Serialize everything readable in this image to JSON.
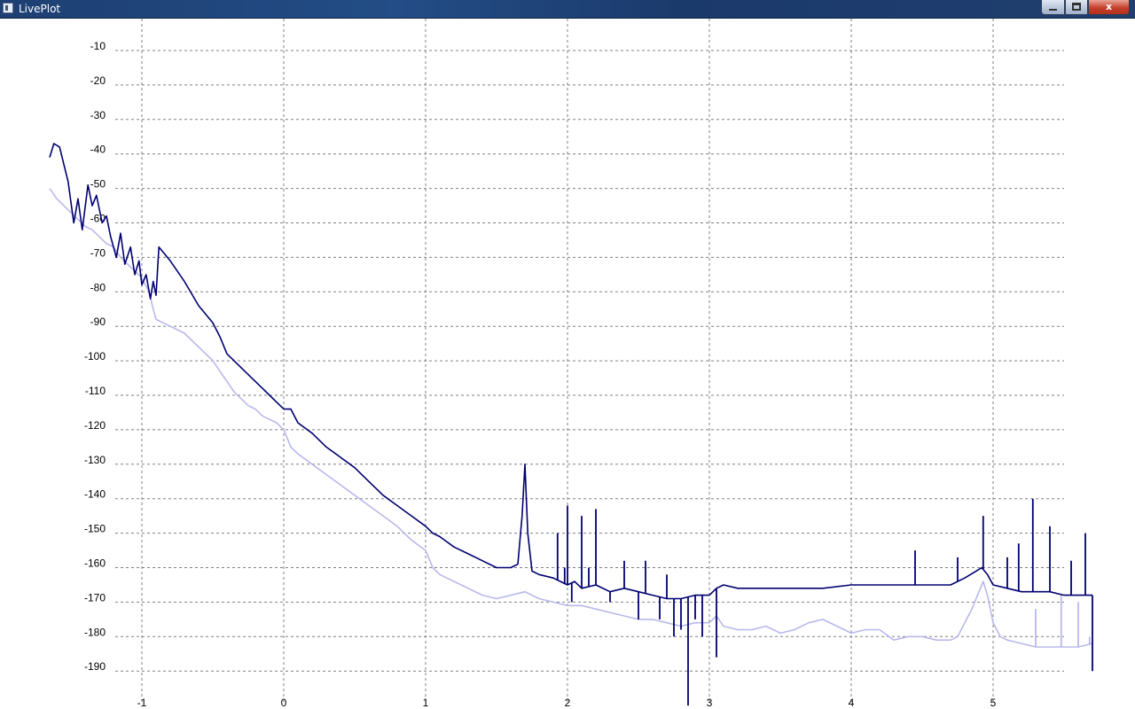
{
  "window": {
    "title": "LivePlot",
    "minimize_label": "",
    "maximize_label": "",
    "close_label": "x"
  },
  "chart_data": {
    "type": "line",
    "title": "",
    "xlabel": "",
    "ylabel": "",
    "xlim": [
      -1.65,
      5.7
    ],
    "ylim": [
      -198,
      0
    ],
    "x_ticks": [
      -1,
      0,
      1,
      2,
      3,
      4,
      5
    ],
    "y_ticks": [
      -10,
      -20,
      -30,
      -40,
      -50,
      -60,
      -70,
      -80,
      -90,
      -100,
      -110,
      -120,
      -130,
      -140,
      -150,
      -160,
      -170,
      -180,
      -190
    ],
    "grid": true,
    "grid_style": "dashed",
    "colors": {
      "dark": "#000070",
      "light": "#b8b8ec",
      "grid": "#808080"
    },
    "series": [
      {
        "color": "#000070",
        "points": [
          [
            -1.65,
            -41
          ],
          [
            -1.62,
            -37
          ],
          [
            -1.58,
            -38
          ],
          [
            -1.55,
            -43
          ],
          [
            -1.52,
            -48
          ],
          [
            -1.48,
            -60
          ],
          [
            -1.45,
            -53
          ],
          [
            -1.42,
            -62
          ],
          [
            -1.38,
            -49
          ],
          [
            -1.35,
            -55
          ],
          [
            -1.32,
            -52
          ],
          [
            -1.28,
            -60
          ],
          [
            -1.25,
            -58
          ],
          [
            -1.22,
            -64
          ],
          [
            -1.18,
            -70
          ],
          [
            -1.15,
            -63
          ],
          [
            -1.12,
            -72
          ],
          [
            -1.08,
            -67
          ],
          [
            -1.05,
            -75
          ],
          [
            -1.02,
            -71
          ],
          [
            -1.0,
            -78
          ],
          [
            -0.97,
            -75
          ],
          [
            -0.94,
            -82
          ],
          [
            -0.92,
            -77
          ],
          [
            -0.9,
            -81
          ],
          [
            -0.88,
            -67
          ],
          [
            -0.8,
            -71
          ],
          [
            -0.7,
            -77
          ],
          [
            -0.6,
            -84
          ],
          [
            -0.5,
            -89
          ],
          [
            -0.45,
            -93
          ],
          [
            -0.4,
            -98
          ],
          [
            -0.35,
            -100
          ],
          [
            -0.3,
            -102
          ],
          [
            -0.25,
            -104
          ],
          [
            -0.2,
            -106
          ],
          [
            -0.15,
            -108
          ],
          [
            -0.1,
            -110
          ],
          [
            -0.05,
            -112
          ],
          [
            0.0,
            -114
          ],
          [
            0.05,
            -114
          ],
          [
            0.1,
            -118
          ],
          [
            0.2,
            -121
          ],
          [
            0.3,
            -125
          ],
          [
            0.4,
            -128
          ],
          [
            0.5,
            -131
          ],
          [
            0.6,
            -135
          ],
          [
            0.7,
            -139
          ],
          [
            0.8,
            -142
          ],
          [
            0.9,
            -145
          ],
          [
            1.0,
            -148
          ],
          [
            1.05,
            -150
          ],
          [
            1.1,
            -151
          ],
          [
            1.2,
            -154
          ],
          [
            1.3,
            -156
          ],
          [
            1.4,
            -158
          ],
          [
            1.5,
            -160
          ],
          [
            1.6,
            -160
          ],
          [
            1.65,
            -159
          ],
          [
            1.68,
            -145
          ],
          [
            1.7,
            -130
          ],
          [
            1.72,
            -150
          ],
          [
            1.75,
            -161
          ],
          [
            1.8,
            -162
          ],
          [
            1.9,
            -163
          ],
          [
            2.0,
            -165
          ],
          [
            2.05,
            -164
          ],
          [
            2.1,
            -166
          ],
          [
            2.2,
            -165
          ],
          [
            2.3,
            -167
          ],
          [
            2.4,
            -166
          ],
          [
            2.5,
            -167
          ],
          [
            2.6,
            -168
          ],
          [
            2.7,
            -169
          ],
          [
            2.8,
            -169
          ],
          [
            2.9,
            -168
          ],
          [
            3.0,
            -168
          ],
          [
            3.05,
            -166
          ],
          [
            3.1,
            -165
          ],
          [
            3.2,
            -166
          ],
          [
            3.4,
            -166
          ],
          [
            3.6,
            -166
          ],
          [
            3.8,
            -166
          ],
          [
            4.0,
            -165
          ],
          [
            4.2,
            -165
          ],
          [
            4.4,
            -165
          ],
          [
            4.6,
            -165
          ],
          [
            4.7,
            -165
          ],
          [
            4.8,
            -163
          ],
          [
            4.88,
            -161
          ],
          [
            4.92,
            -160
          ],
          [
            4.96,
            -162
          ],
          [
            5.0,
            -165
          ],
          [
            5.1,
            -166
          ],
          [
            5.2,
            -167
          ],
          [
            5.3,
            -167
          ],
          [
            5.4,
            -167
          ],
          [
            5.5,
            -168
          ],
          [
            5.6,
            -168
          ],
          [
            5.7,
            -168
          ]
        ],
        "spikes": [
          [
            1.93,
            -150
          ],
          [
            1.98,
            -160
          ],
          [
            2.0,
            -142
          ],
          [
            2.03,
            -170
          ],
          [
            2.1,
            -145
          ],
          [
            2.15,
            -160
          ],
          [
            2.2,
            -143
          ],
          [
            2.3,
            -170
          ],
          [
            2.4,
            -158
          ],
          [
            2.5,
            -175
          ],
          [
            2.55,
            -158
          ],
          [
            2.65,
            -175
          ],
          [
            2.7,
            -162
          ],
          [
            2.75,
            -180
          ],
          [
            2.8,
            -178
          ],
          [
            2.85,
            -200
          ],
          [
            2.9,
            -175
          ],
          [
            2.95,
            -180
          ],
          [
            3.05,
            -186
          ],
          [
            4.45,
            -155
          ],
          [
            4.75,
            -157
          ],
          [
            4.93,
            -145
          ],
          [
            5.1,
            -157
          ],
          [
            5.18,
            -153
          ],
          [
            5.28,
            -140
          ],
          [
            5.4,
            -148
          ],
          [
            5.55,
            -158
          ],
          [
            5.65,
            -150
          ],
          [
            5.7,
            -190
          ]
        ]
      },
      {
        "color": "#b8b8ec",
        "points": [
          [
            -1.65,
            -50
          ],
          [
            -1.6,
            -53
          ],
          [
            -1.55,
            -55
          ],
          [
            -1.5,
            -57
          ],
          [
            -1.45,
            -59
          ],
          [
            -1.4,
            -61
          ],
          [
            -1.35,
            -62
          ],
          [
            -1.3,
            -64
          ],
          [
            -1.25,
            -66
          ],
          [
            -1.2,
            -67
          ],
          [
            -1.15,
            -70
          ],
          [
            -1.1,
            -72
          ],
          [
            -1.05,
            -74
          ],
          [
            -1.0,
            -76
          ],
          [
            -0.95,
            -80
          ],
          [
            -0.92,
            -85
          ],
          [
            -0.9,
            -88
          ],
          [
            -0.85,
            -89
          ],
          [
            -0.8,
            -90
          ],
          [
            -0.7,
            -92
          ],
          [
            -0.6,
            -96
          ],
          [
            -0.5,
            -100
          ],
          [
            -0.45,
            -103
          ],
          [
            -0.4,
            -106
          ],
          [
            -0.35,
            -109
          ],
          [
            -0.3,
            -111
          ],
          [
            -0.25,
            -113
          ],
          [
            -0.2,
            -114
          ],
          [
            -0.15,
            -116
          ],
          [
            -0.1,
            -117
          ],
          [
            -0.05,
            -118
          ],
          [
            0.0,
            -120
          ],
          [
            0.05,
            -125
          ],
          [
            0.1,
            -127
          ],
          [
            0.2,
            -130
          ],
          [
            0.3,
            -133
          ],
          [
            0.4,
            -136
          ],
          [
            0.5,
            -139
          ],
          [
            0.6,
            -142
          ],
          [
            0.7,
            -145
          ],
          [
            0.8,
            -148
          ],
          [
            0.9,
            -152
          ],
          [
            1.0,
            -155
          ],
          [
            1.05,
            -160
          ],
          [
            1.1,
            -162
          ],
          [
            1.2,
            -164
          ],
          [
            1.3,
            -166
          ],
          [
            1.4,
            -168
          ],
          [
            1.5,
            -169
          ],
          [
            1.6,
            -168
          ],
          [
            1.7,
            -167
          ],
          [
            1.8,
            -169
          ],
          [
            1.9,
            -170
          ],
          [
            2.0,
            -171
          ],
          [
            2.1,
            -171
          ],
          [
            2.2,
            -172
          ],
          [
            2.3,
            -173
          ],
          [
            2.4,
            -174
          ],
          [
            2.5,
            -175
          ],
          [
            2.6,
            -175
          ],
          [
            2.7,
            -176
          ],
          [
            2.8,
            -177
          ],
          [
            2.9,
            -176
          ],
          [
            3.0,
            -176
          ],
          [
            3.05,
            -174
          ],
          [
            3.1,
            -177
          ],
          [
            3.2,
            -178
          ],
          [
            3.3,
            -178
          ],
          [
            3.4,
            -177
          ],
          [
            3.5,
            -179
          ],
          [
            3.6,
            -178
          ],
          [
            3.7,
            -176
          ],
          [
            3.8,
            -175
          ],
          [
            3.9,
            -177
          ],
          [
            4.0,
            -179
          ],
          [
            4.1,
            -178
          ],
          [
            4.2,
            -178
          ],
          [
            4.3,
            -181
          ],
          [
            4.4,
            -180
          ],
          [
            4.5,
            -180
          ],
          [
            4.6,
            -181
          ],
          [
            4.7,
            -181
          ],
          [
            4.75,
            -180
          ],
          [
            4.8,
            -176
          ],
          [
            4.85,
            -172
          ],
          [
            4.9,
            -167
          ],
          [
            4.93,
            -164
          ],
          [
            4.96,
            -168
          ],
          [
            5.0,
            -176
          ],
          [
            5.05,
            -180
          ],
          [
            5.1,
            -181
          ],
          [
            5.2,
            -182
          ],
          [
            5.3,
            -183
          ],
          [
            5.4,
            -183
          ],
          [
            5.5,
            -183
          ],
          [
            5.6,
            -183
          ],
          [
            5.7,
            -182
          ]
        ],
        "spikes": [
          [
            5.3,
            -172
          ],
          [
            5.48,
            -168
          ],
          [
            5.6,
            -170
          ],
          [
            5.68,
            -180
          ]
        ]
      }
    ]
  }
}
